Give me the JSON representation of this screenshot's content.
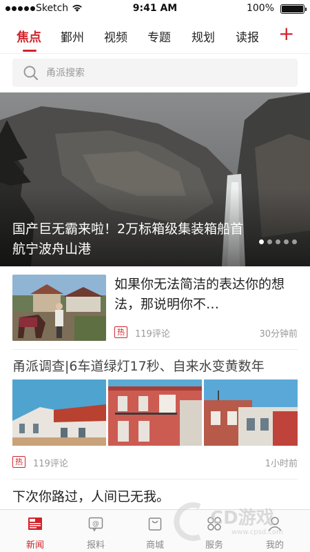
{
  "status_bar": {
    "carrier": "Sketch",
    "time": "9:41 AM",
    "battery": "100%",
    "battery_level": 1.0
  },
  "channels": {
    "tabs": [
      "焦点",
      "鄞州",
      "视频",
      "专题",
      "规划",
      "读报"
    ],
    "active_index": 0,
    "add_label": "+"
  },
  "search": {
    "placeholder": "甬派搜索",
    "value": ""
  },
  "hero": {
    "title": "国产巨无霸来啦！2万标箱级集装箱船首航宁波舟山港",
    "slide_count": 5,
    "active_slide": 0
  },
  "articles": [
    {
      "title": "如果你无法简洁的表达你的想法，那说明你不…",
      "badge": "热",
      "comments": "119评论",
      "time": "30分钟前"
    },
    {
      "title": "甬派调查|6车道绿灯17秒、自来水变黄数年",
      "badge": "热",
      "comments": "119评论",
      "time": "1小时前"
    },
    {
      "title": "下次你路过，人间已无我。"
    }
  ],
  "tabbar": {
    "items": [
      {
        "label": "新闻",
        "icon": "news-icon"
      },
      {
        "label": "报料",
        "icon": "report-icon"
      },
      {
        "label": "商城",
        "icon": "shop-bag-icon"
      },
      {
        "label": "服务",
        "icon": "service-grid-icon"
      },
      {
        "label": "我的",
        "icon": "profile-icon"
      }
    ],
    "active_index": 0
  },
  "watermark": {
    "text": "CD游戏",
    "url": "www.cpsd.com"
  },
  "colors": {
    "accent": "#d2232a",
    "muted": "#999999"
  }
}
